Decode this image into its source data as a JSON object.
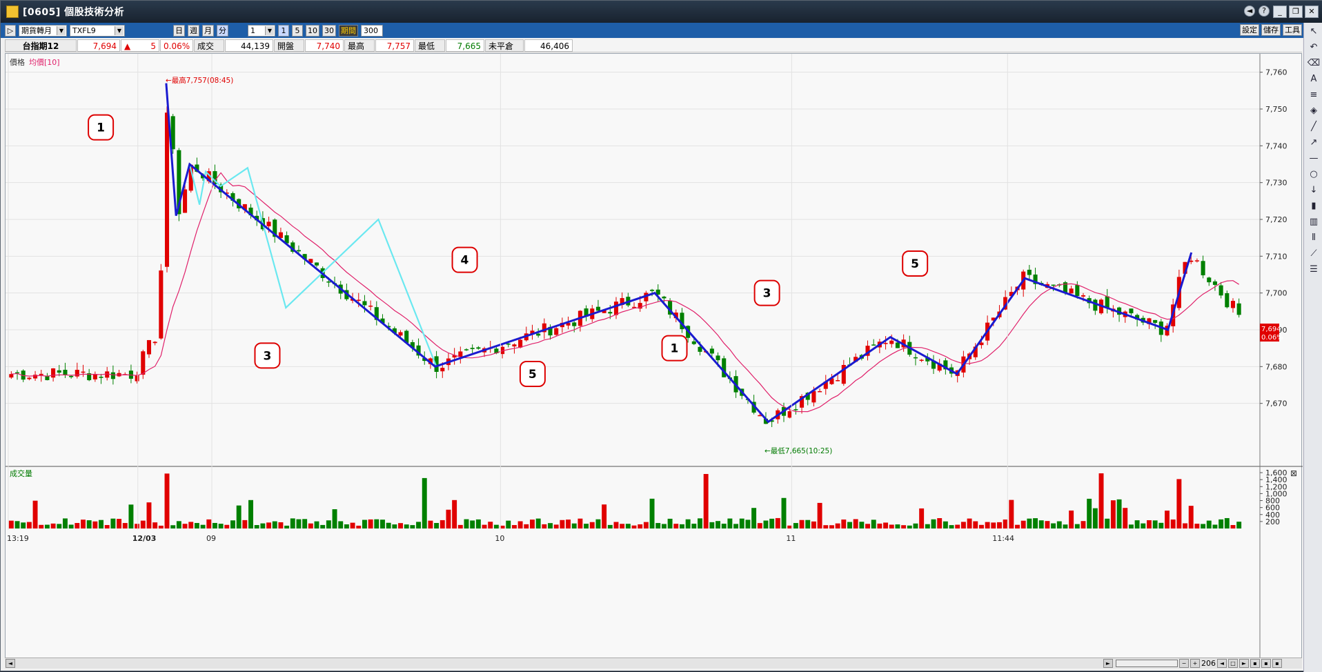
{
  "window": {
    "title": "[0605] 個股技術分析",
    "buttons": [
      "◄",
      "?",
      "_",
      "❐",
      "✕"
    ]
  },
  "toolbar": {
    "period_select": "期貨轉月",
    "symbol_select": "TXFL9",
    "period_buttons": [
      "日",
      "週",
      "月",
      "分"
    ],
    "interval_select": "1",
    "interval_buttons": [
      "1",
      "5",
      "10",
      "30"
    ],
    "range_label": "期間",
    "range_value": "300",
    "right_buttons": [
      "設定",
      "儲存",
      "工具"
    ]
  },
  "quote": {
    "name": "台指期12",
    "price": "7,694",
    "arrow": "▲",
    "change": "5",
    "change_pct": "0.06%",
    "vol_label": "成交量",
    "vol": "44,139",
    "open_label": "開盤價",
    "open": "7,740",
    "high_label": "最高價",
    "high": "7,757",
    "low_label": "最低價",
    "low": "7,665",
    "oi_label": "未平倉量",
    "oi": "46,406"
  },
  "price_panel": {
    "label": "價格",
    "ma_label": "均價[10]",
    "high_note": "←最高7,757(08:45)",
    "low_note": "←最低7,665(10:25)",
    "last_price": "7,694",
    "last_pct": "0.06%"
  },
  "volume_panel": {
    "label": "成交量",
    "close": "⊠"
  },
  "wave_labels": [
    "1",
    "3",
    "4",
    "5",
    "1",
    "3",
    "5"
  ],
  "chart_data": {
    "type": "candlestick",
    "price_axis": {
      "ticks": [
        7760,
        7750,
        7740,
        7730,
        7720,
        7710,
        7700,
        7690,
        7680,
        7670
      ],
      "range": [
        7660,
        7765
      ]
    },
    "volume_axis": {
      "ticks": [
        "1,600",
        "1,400",
        "1,200",
        "1,000",
        "800",
        "600",
        "400",
        "200"
      ],
      "range": [
        0,
        1700
      ]
    },
    "x_ticks": [
      "13:19",
      "12/03",
      "09",
      "10",
      "11",
      "11:44"
    ],
    "candle_count": 206,
    "wave_paths": {
      "blue": [
        [
          0.128,
          7757
        ],
        [
          0.136,
          7721
        ],
        [
          0.147,
          7735
        ],
        [
          0.346,
          7680
        ],
        [
          0.524,
          7700
        ],
        [
          0.616,
          7665
        ],
        [
          0.715,
          7688
        ],
        [
          0.769,
          7678
        ],
        [
          0.824,
          7704
        ],
        [
          0.94,
          7690
        ],
        [
          0.959,
          7711
        ]
      ],
      "cyan": [
        [
          0.147,
          7735
        ],
        [
          0.155,
          7724
        ],
        [
          0.16,
          7733
        ],
        [
          0.172,
          7729
        ],
        [
          0.194,
          7734
        ],
        [
          0.225,
          7696
        ],
        [
          0.3,
          7720
        ],
        [
          0.347,
          7680
        ]
      ]
    }
  },
  "bottom": {
    "zoom_value": "206"
  },
  "colors": {
    "up": "#e00000",
    "down": "#008000",
    "ma": "#e0206a",
    "wave": "#1a1ad0",
    "wave2": "#6ae8f0"
  }
}
